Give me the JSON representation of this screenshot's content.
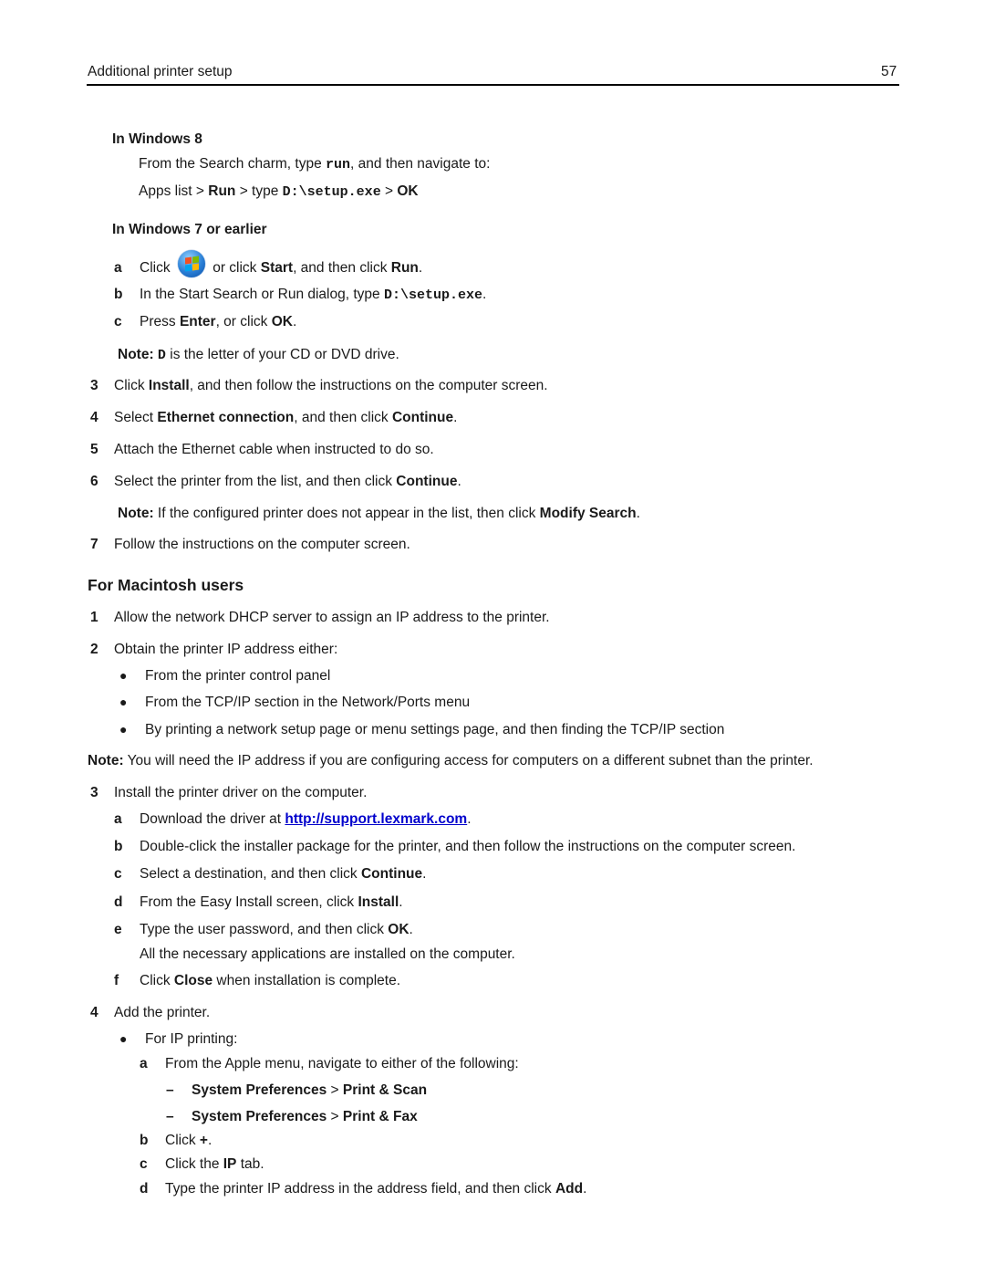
{
  "header": {
    "title": "Additional printer setup",
    "page_number": "57"
  },
  "windows8": {
    "heading": "In Windows 8",
    "line1_pre": "From the Search charm, type ",
    "line1_code": "run",
    "line1_post": ", and then navigate to:",
    "line2_a": "Apps list > ",
    "line2_run": "Run",
    "line2_b": " > type ",
    "line2_code": "D:\\setup.exe",
    "line2_c": " > ",
    "line2_ok": "OK"
  },
  "windows7": {
    "heading": "In Windows 7 or earlier",
    "steps": [
      {
        "letter": "a",
        "pre": "Click ",
        "icon": "windows-start-icon",
        "mid": " or click ",
        "bold1": "Start",
        "mid2": ", and then click ",
        "bold2": "Run",
        "post": "."
      },
      {
        "letter": "b",
        "pre": "In the Start Search or Run dialog, type ",
        "code": "D:\\setup.exe",
        "post": "."
      },
      {
        "letter": "c",
        "pre": "Press ",
        "bold1": "Enter",
        "mid": ", or click ",
        "bold2": "OK",
        "post": "."
      }
    ],
    "note_label": "Note:",
    "note_code": "D",
    "note_text": " is the letter of your CD or DVD drive."
  },
  "windows_steps": [
    {
      "num": "3",
      "pre": "Click ",
      "bold1": "Install",
      "post": ", and then follow the instructions on the computer screen."
    },
    {
      "num": "4",
      "pre": "Select ",
      "bold1": "Ethernet connection",
      "mid": ", and then click ",
      "bold2": "Continue",
      "post": "."
    },
    {
      "num": "5",
      "text": "Attach the Ethernet cable when instructed to do so."
    },
    {
      "num": "6",
      "pre": "Select the printer from the list, and then click ",
      "bold1": "Continue",
      "post": "."
    },
    {
      "num": "7",
      "text": "Follow the instructions on the computer screen."
    }
  ],
  "windows_note": {
    "label": "Note:",
    "pre": " If the configured printer does not appear in the list, then click ",
    "bold": "Modify Search",
    "post": "."
  },
  "mac": {
    "heading": "For Macintosh users",
    "step1": {
      "num": "1",
      "text": "Allow the network DHCP server to assign an IP address to the printer."
    },
    "step2": {
      "num": "2",
      "text": "Obtain the printer IP address either:"
    },
    "bullets": [
      "From the printer control panel",
      "From the TCP/IP section in the Network/Ports menu",
      "By printing a network setup page or menu settings page, and then finding the TCP/IP section"
    ],
    "note_label": "Note:",
    "note_text": " You will need the IP address if you are configuring access for computers on a different subnet than the printer.",
    "step3": {
      "num": "3",
      "text": "Install the printer driver on the computer."
    },
    "step3_sub": {
      "a_letter": "a",
      "a_pre": "Download the driver at ",
      "a_link": "http://support.lexmark.com",
      "a_post": ".",
      "b_letter": "b",
      "b_text": "Double-click the installer package for the printer, and then follow the instructions on the computer screen.",
      "c_letter": "c",
      "c_pre": "Select a destination, and then click ",
      "c_bold": "Continue",
      "c_post": ".",
      "d_letter": "d",
      "d_pre": "From the Easy Install screen, click ",
      "d_bold": "Install",
      "d_post": ".",
      "e_letter": "e",
      "e_pre": "Type the user password, and then click ",
      "e_bold": "OK",
      "e_post": ".",
      "e_result": "All the necessary applications are installed on the computer.",
      "f_letter": "f",
      "f_pre": "Click ",
      "f_bold": "Close",
      "f_post": " when installation is complete."
    },
    "step4": {
      "num": "4",
      "text": "Add the printer."
    },
    "step4_bullet": "For IP printing:",
    "step4_sub": {
      "a_letter": "a",
      "a_text": "From the Apple menu, navigate to either of the following:",
      "dash1_b1": "System Preferences",
      "dash1_sep": " > ",
      "dash1_b2": "Print & Scan",
      "dash2_b1": "System Preferences",
      "dash2_sep": " > ",
      "dash2_b2": "Print & Fax",
      "b_letter": "b",
      "b_pre": "Click ",
      "b_bold": "+",
      "b_post": ".",
      "c_letter": "c",
      "c_pre": "Click the ",
      "c_bold": "IP",
      "c_post": " tab.",
      "d_letter": "d",
      "d_pre": "Type the printer IP address in the address field, and then click ",
      "d_bold": "Add",
      "d_post": "."
    }
  }
}
